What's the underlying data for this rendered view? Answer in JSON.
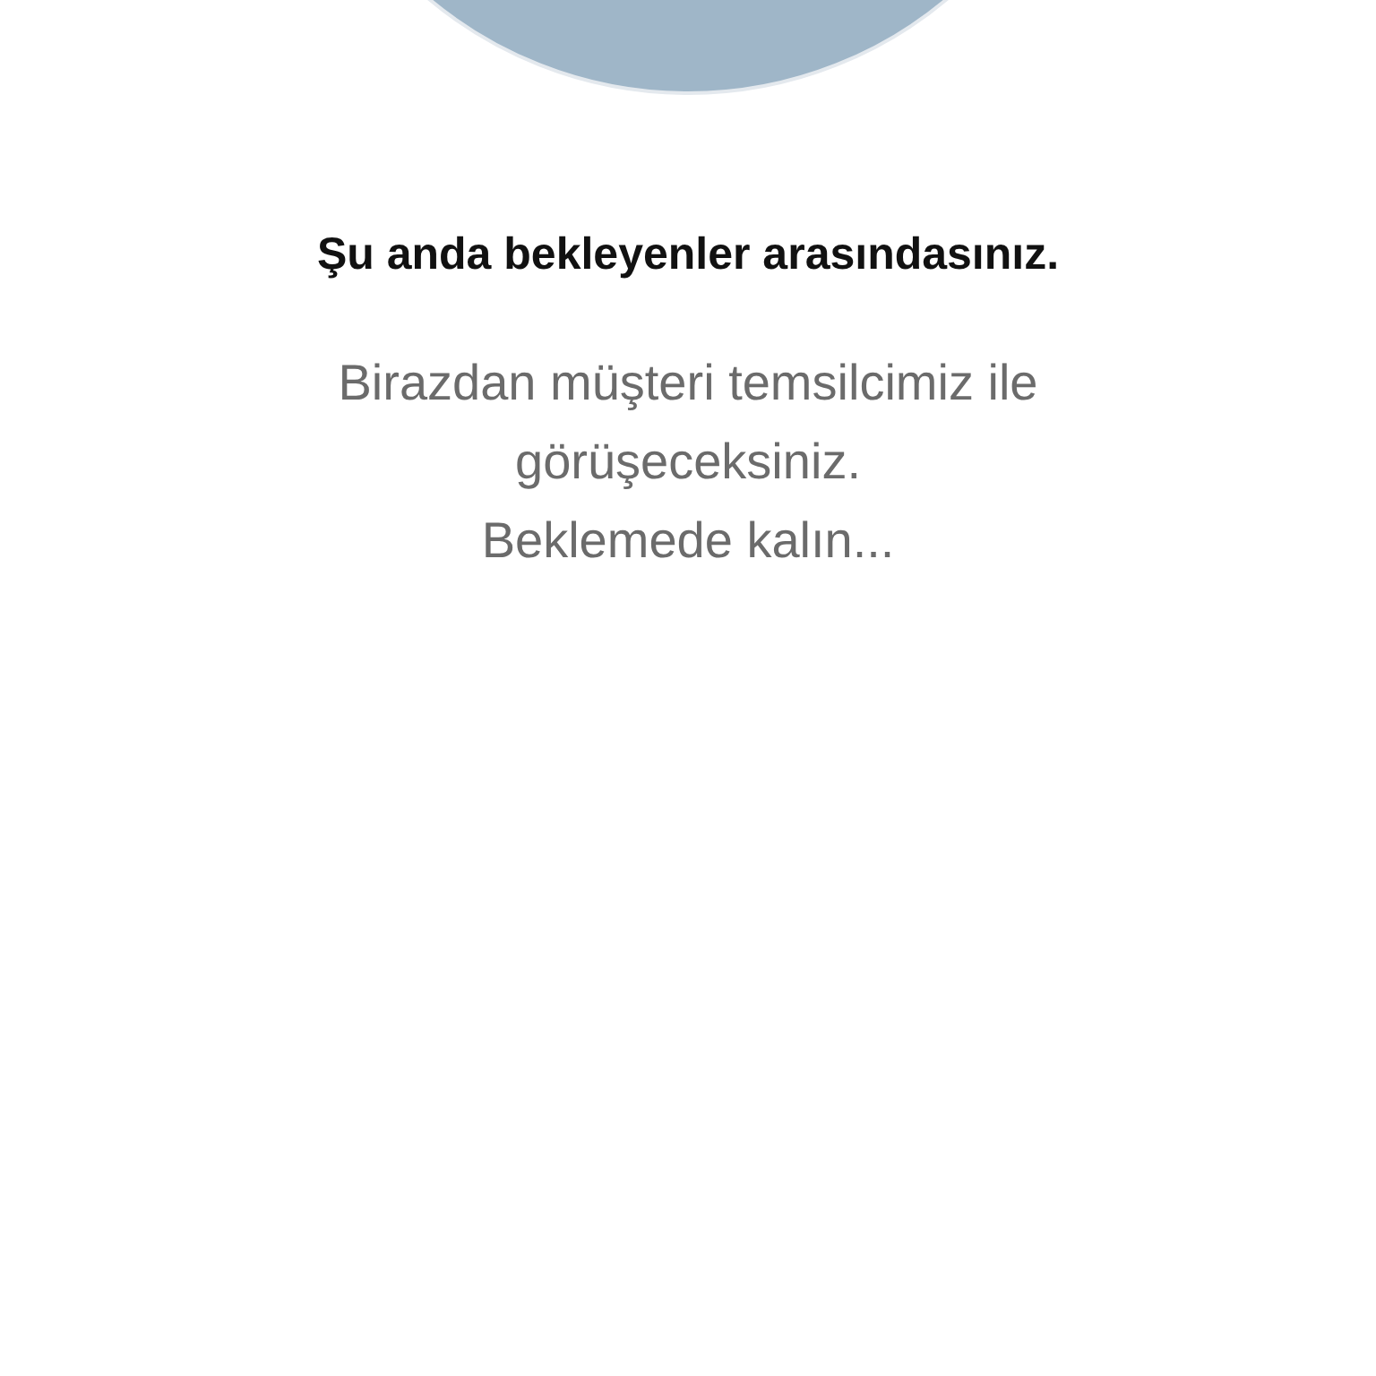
{
  "avatar": {
    "kind": "placeholder"
  },
  "title": "Şu anda bekleyenler arasındasınız.",
  "message": "Birazdan müşteri temsilcimiz ile görüşeceksiniz.",
  "hint": "Beklemede kalın..."
}
